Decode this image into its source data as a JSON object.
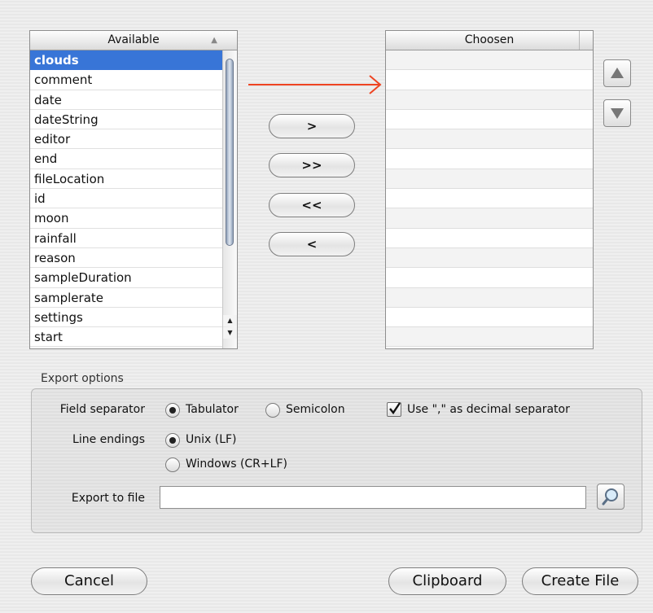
{
  "available": {
    "header": "Available",
    "items": [
      "clouds",
      "comment",
      "date",
      "dateString",
      "editor",
      "end",
      "fileLocation",
      "id",
      "moon",
      "rainfall",
      "reason",
      "sampleDuration",
      "samplerate",
      "settings",
      "start"
    ],
    "selected_item": "clouds"
  },
  "chosen": {
    "header": "Choosen",
    "items": []
  },
  "transfer_buttons": {
    "add": ">",
    "add_all": ">>",
    "remove_all": "<<",
    "remove": "<"
  },
  "export_options": {
    "section_label": "Export options",
    "field_separator": {
      "label": "Field separator",
      "options": [
        "Tabulator",
        "Semicolon"
      ],
      "selected": "Tabulator"
    },
    "decimal_separator": {
      "label": "Use \",\" as decimal separator",
      "checked": true
    },
    "line_endings": {
      "label": "Line endings",
      "options": [
        "Unix (LF)",
        "Windows (CR+LF)"
      ],
      "selected": "Unix (LF)"
    },
    "export_file": {
      "label": "Export to file",
      "value": ""
    }
  },
  "buttons": {
    "cancel": "Cancel",
    "clipboard": "Clipboard",
    "create_file": "Create File"
  },
  "colors": {
    "selection": "#3875d7",
    "arrow": "#ee4422"
  },
  "icons": {
    "move_up": "triangle-up-icon",
    "move_down": "triangle-down-icon",
    "browse": "magnifier-icon"
  }
}
